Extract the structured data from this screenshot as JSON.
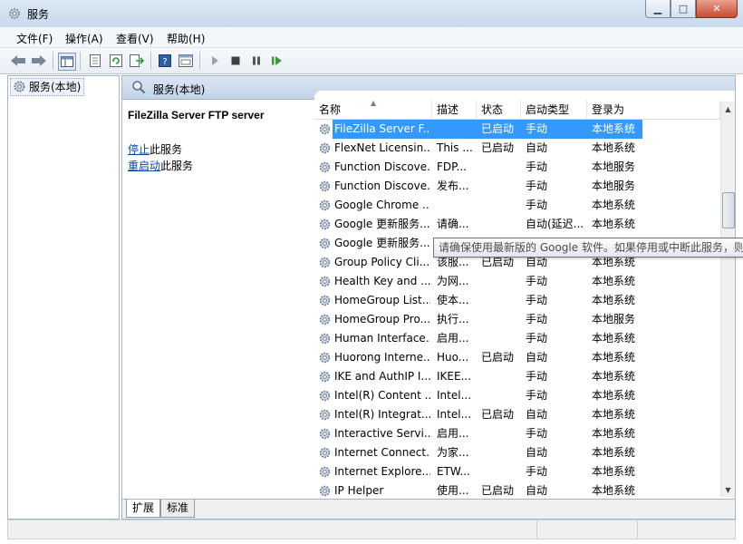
{
  "window": {
    "title": "服务"
  },
  "menu": [
    "文件(F)",
    "操作(A)",
    "查看(V)",
    "帮助(H)"
  ],
  "tree": {
    "root": "服务(本地)"
  },
  "main": {
    "header": "服务(本地)"
  },
  "details": {
    "service_name": "FileZilla Server FTP server",
    "stop_link": "停止",
    "stop_suffix": "此服务",
    "restart_link": "重启动",
    "restart_suffix": "此服务"
  },
  "columns": [
    "名称",
    "描述",
    "状态",
    "启动类型",
    "登录为"
  ],
  "rows": [
    {
      "name": "FileZilla Server F...",
      "desc": "",
      "status": "已启动",
      "startup": "手动",
      "logon": "本地系统",
      "selected": true
    },
    {
      "name": "FlexNet Licensin...",
      "desc": "This ...",
      "status": "已启动",
      "startup": "自动",
      "logon": "本地系统"
    },
    {
      "name": "Function Discove...",
      "desc": "FDP...",
      "status": "",
      "startup": "手动",
      "logon": "本地服务"
    },
    {
      "name": "Function Discove...",
      "desc": "发布...",
      "status": "",
      "startup": "手动",
      "logon": "本地服务"
    },
    {
      "name": "Google Chrome ...",
      "desc": "",
      "status": "",
      "startup": "手动",
      "logon": "本地系统"
    },
    {
      "name": "Google 更新服务...",
      "desc": "请确...",
      "status": "",
      "startup": "自动(延迟...",
      "logon": "本地系统"
    },
    {
      "name": "Google 更新服务...",
      "desc": "",
      "status": "",
      "startup": "",
      "logon": ""
    },
    {
      "name": "Group Policy Cli...",
      "desc": "该服...",
      "status": "已启动",
      "startup": "自动",
      "logon": "本地系统"
    },
    {
      "name": "Health Key and ...",
      "desc": "为网...",
      "status": "",
      "startup": "手动",
      "logon": "本地系统"
    },
    {
      "name": "HomeGroup List...",
      "desc": "使本...",
      "status": "",
      "startup": "手动",
      "logon": "本地系统"
    },
    {
      "name": "HomeGroup Pro...",
      "desc": "执行...",
      "status": "",
      "startup": "手动",
      "logon": "本地服务"
    },
    {
      "name": "Human Interface...",
      "desc": "启用...",
      "status": "",
      "startup": "手动",
      "logon": "本地系统"
    },
    {
      "name": "Huorong Interne...",
      "desc": "Huo...",
      "status": "已启动",
      "startup": "自动",
      "logon": "本地系统"
    },
    {
      "name": "IKE and AuthIP I...",
      "desc": "IKEE...",
      "status": "",
      "startup": "手动",
      "logon": "本地系统"
    },
    {
      "name": "Intel(R) Content ...",
      "desc": "Intel...",
      "status": "",
      "startup": "手动",
      "logon": "本地系统"
    },
    {
      "name": "Intel(R) Integrat...",
      "desc": "Intel...",
      "status": "已启动",
      "startup": "自动",
      "logon": "本地系统"
    },
    {
      "name": "Interactive Servi...",
      "desc": "启用...",
      "status": "",
      "startup": "手动",
      "logon": "本地系统"
    },
    {
      "name": "Internet Connect...",
      "desc": "为家...",
      "status": "",
      "startup": "自动",
      "logon": "本地系统"
    },
    {
      "name": "Internet Explore...",
      "desc": "ETW...",
      "status": "",
      "startup": "手动",
      "logon": "本地系统"
    },
    {
      "name": "IP Helper",
      "desc": "使用...",
      "status": "已启动",
      "startup": "自动",
      "logon": "本地系统"
    }
  ],
  "tooltip": "请确保使用最新版的 Google 软件。如果停用或中断此服务，则",
  "tabs": [
    "扩展",
    "标准"
  ],
  "colors": {
    "selection": "#3399ff",
    "link": "#0645ad",
    "frame": "#c8d9ec"
  }
}
